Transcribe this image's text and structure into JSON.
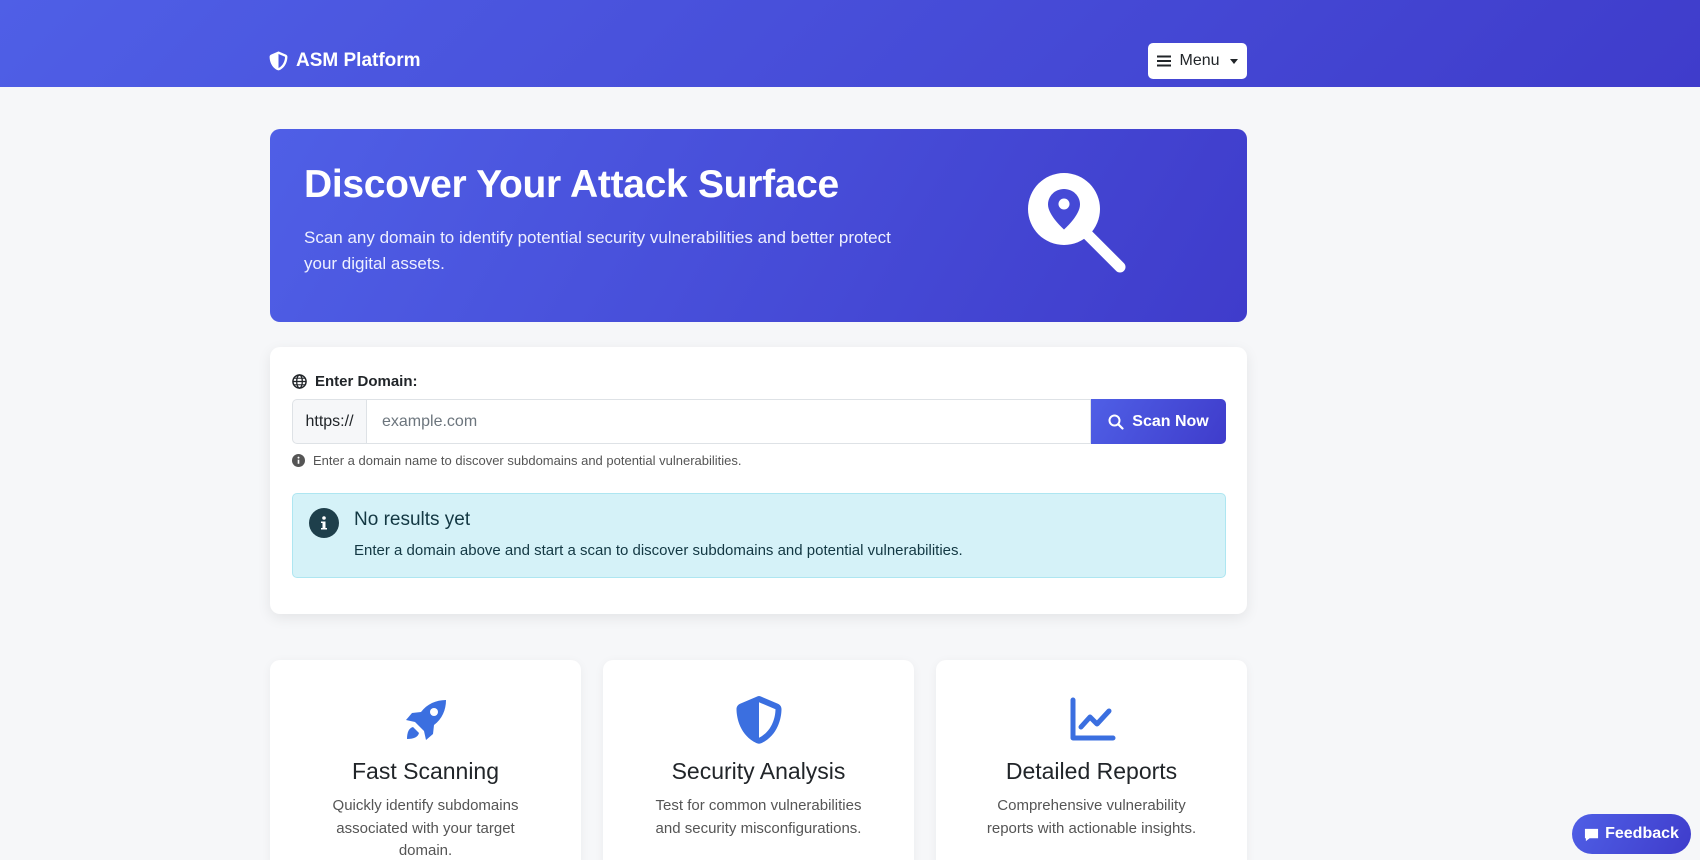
{
  "navbar": {
    "brand": "ASM Platform",
    "brand_icon": "shield-icon",
    "menu_label": "Menu",
    "menu_icon": "hamburger-icon"
  },
  "hero": {
    "title": "Discover Your Attack Surface",
    "subtitle": "Scan any domain to identify potential security vulnerabilities and better protect your digital assets.",
    "icon": "search-location-icon"
  },
  "scan_form": {
    "label": "Enter Domain:",
    "label_icon": "globe-icon",
    "prefix": "https://",
    "input_value": "",
    "placeholder": "example.com",
    "button_label": "Scan Now",
    "help_text": "Enter a domain name to discover subdomains and potential vulnerabilities."
  },
  "alert": {
    "title": "No results yet",
    "message": "Enter a domain above and start a scan to discover subdomains and potential vulnerabilities."
  },
  "features": [
    {
      "icon": "rocket-icon",
      "title": "Fast Scanning",
      "description": "Quickly identify subdomains associated with your target domain."
    },
    {
      "icon": "shield-icon",
      "title": "Security Analysis",
      "description": "Test for common vulnerabilities and security misconfigurations."
    },
    {
      "icon": "chart-line-icon",
      "title": "Detailed Reports",
      "description": "Comprehensive vulnerability reports with actionable insights."
    }
  ],
  "feedback": {
    "label": "Feedback"
  },
  "colors": {
    "primary_start": "#4f5fe6",
    "primary_end": "#3f3ccb",
    "feature_icon": "#3b6fe0",
    "alert_bg": "#d5f2f8",
    "page_bg": "#f6f7f9"
  }
}
